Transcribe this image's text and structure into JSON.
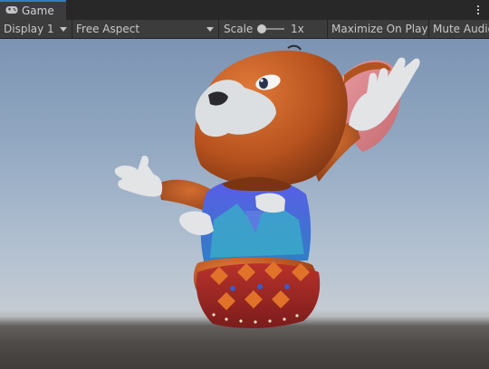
{
  "tab": {
    "title": "Game",
    "icon": "gamepad-icon"
  },
  "menu": {
    "icon": "more-options-icon"
  },
  "toolbar": {
    "display": "Display 1",
    "aspect": "Free Aspect",
    "scale_label": "Scale",
    "scale_value": "1x",
    "scale_slider": {
      "value": 1
    },
    "maximize": "Maximize On Play",
    "mute": "Mute Audio"
  },
  "colors": {
    "tab_accent": "#3a79bb",
    "sky_top": "#7c94b3",
    "ground": "#4e4b49"
  }
}
